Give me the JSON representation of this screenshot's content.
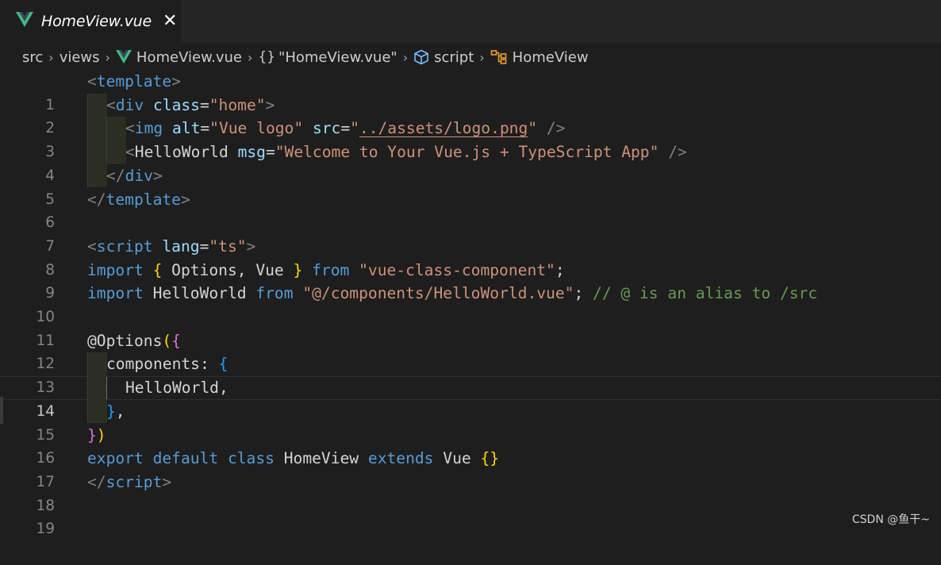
{
  "tab": {
    "icon": "vue-logo-icon",
    "label": "HomeView.vue",
    "close": "✕"
  },
  "breadcrumb": {
    "items": [
      "src",
      "views",
      "HomeView.vue",
      "\"HomeView.vue\"",
      "script",
      "HomeView"
    ],
    "icons": [
      "vue-logo-icon",
      "braces-icon",
      "cube-icon",
      "class-icon"
    ],
    "braces_glyph": "{}",
    "separator": "›"
  },
  "active_line": 14,
  "line_numbers": [
    "1",
    "2",
    "3",
    "4",
    "5",
    "6",
    "7",
    "8",
    "9",
    "10",
    "11",
    "12",
    "13",
    "14",
    "15",
    "16",
    "17",
    "18",
    "19"
  ],
  "code": {
    "l1": [
      "<",
      "template",
      ">"
    ],
    "l2": [
      "<",
      "div",
      " ",
      "class",
      "=",
      "\"home\"",
      ">"
    ],
    "l3": [
      "<",
      "img",
      " ",
      "alt",
      "=",
      "\"Vue logo\"",
      " ",
      "src",
      "=",
      "\"",
      "../assets/logo.png",
      "\"",
      " />"
    ],
    "l4": [
      "<",
      "HelloWorld",
      " ",
      "msg",
      "=",
      "\"Welcome to Your Vue.js + TypeScript App\"",
      " />"
    ],
    "l5": [
      "</",
      "div",
      ">"
    ],
    "l6": [
      "</",
      "template",
      ">"
    ],
    "l8": [
      "<",
      "script",
      " ",
      "lang",
      "=",
      "\"ts\"",
      ">"
    ],
    "l9": [
      "import",
      " ",
      "{",
      " Options, Vue ",
      "}",
      " ",
      "from",
      " ",
      "\"vue-class-component\"",
      ";"
    ],
    "l10": [
      "import",
      " HelloWorld ",
      "from",
      " ",
      "\"@/components/HelloWorld.vue\"",
      "; ",
      "// @ is an alias to /src"
    ],
    "l12": [
      "@Options",
      "(",
      "{"
    ],
    "l13": [
      "components: ",
      "{"
    ],
    "l14": [
      "HelloWorld,"
    ],
    "l15": [
      "}",
      ","
    ],
    "l16": [
      "}",
      ")"
    ],
    "l17": [
      "export",
      " ",
      "default",
      " ",
      "class",
      " HomeView ",
      "extends",
      " Vue ",
      "{}"
    ],
    "l18": [
      "</",
      "script",
      ">"
    ]
  },
  "watermark": "CSDN @鱼干~",
  "colors": {
    "background": "#1e1e1e",
    "tag": "#569cd6",
    "attribute": "#9cdcfe",
    "string": "#ce9178",
    "comment": "#6a9955",
    "bracket_gold": "#ffd700",
    "bracket_purple": "#da70d6",
    "bracket_blue": "#179fff",
    "vue_green": "#41b883",
    "breadcrumb_orange": "#ee9d28",
    "breadcrumb_blue": "#75beff"
  }
}
